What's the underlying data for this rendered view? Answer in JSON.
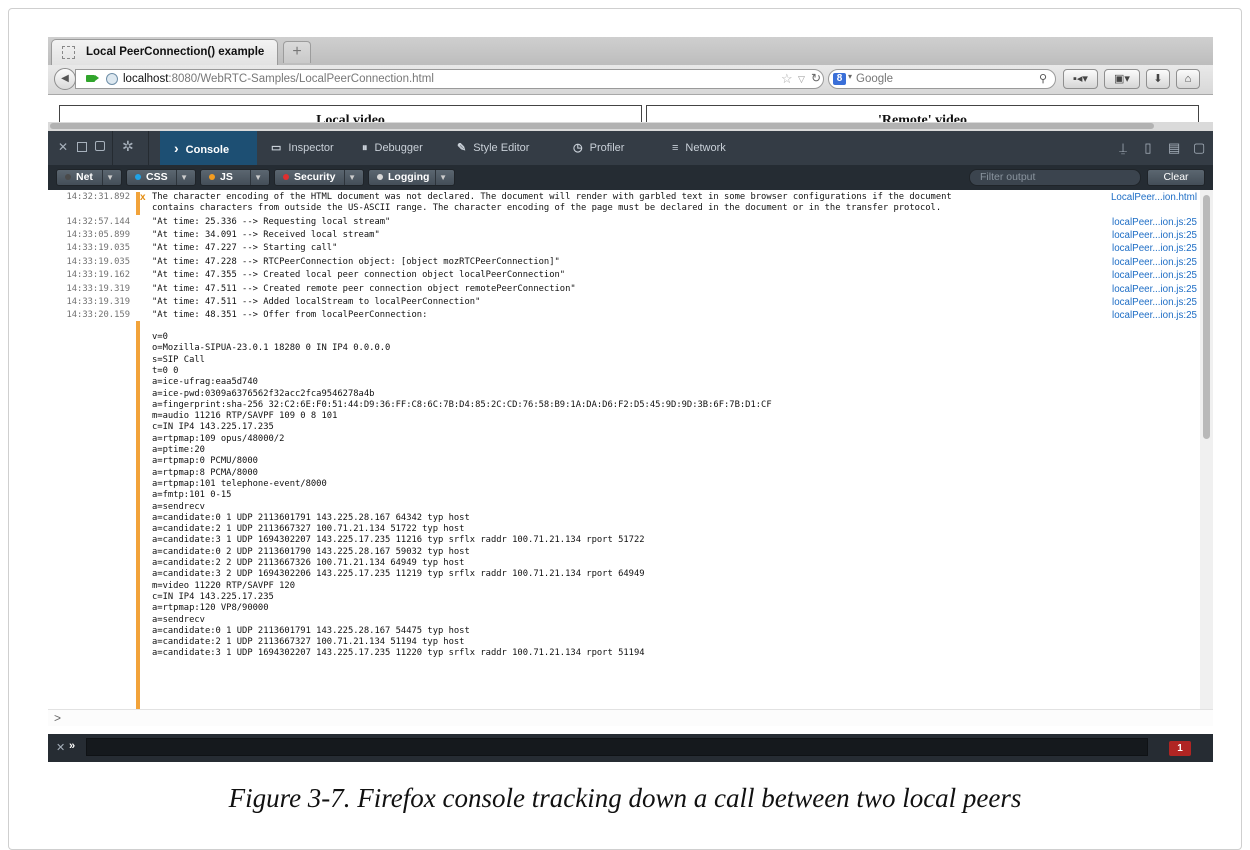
{
  "browser": {
    "tab_title": "Local PeerConnection() example",
    "new_tab_label": "+",
    "url_host": "localhost",
    "url_rest": ":8080/WebRTC-Samples/LocalPeerConnection.html",
    "search_engine_letter": "8",
    "search_placeholder": "Google"
  },
  "page": {
    "local_video_title": "Local video",
    "remote_video_title": "'Remote' video"
  },
  "devtools": {
    "tabs": [
      {
        "label": "Console",
        "icon": "chevron-right-icon"
      },
      {
        "label": "Inspector",
        "icon": "inspector-box-icon"
      },
      {
        "label": "Debugger",
        "icon": "pause-circle-icon"
      },
      {
        "label": "Style Editor",
        "icon": "pencil-icon"
      },
      {
        "label": "Profiler",
        "icon": "clock-icon"
      },
      {
        "label": "Network",
        "icon": "network-lines-icon"
      }
    ],
    "active_tab": "Console",
    "filters": [
      {
        "label": "Net",
        "dot_color": "#4a4a4a"
      },
      {
        "label": "CSS",
        "dot_color": "#1fa2e6"
      },
      {
        "label": "JS",
        "dot_color": "#f39c1f"
      },
      {
        "label": "Security",
        "dot_color": "#e02f2f"
      },
      {
        "label": "Logging",
        "dot_color": "#d8d8d8"
      }
    ],
    "filter_placeholder": "Filter output",
    "clear_label": "Clear",
    "error_count": "1"
  },
  "console": {
    "warning": {
      "time": "14:32:31.892",
      "icon": "x",
      "lines": [
        "The character encoding of the HTML document was not declared. The document will render with garbled text in some browser configurations if the document",
        "contains characters from outside the US-ASCII range. The character encoding of the page must be declared in the document or in the transfer protocol."
      ],
      "source": "LocalPeer...ion.html"
    },
    "messages": [
      {
        "time": "14:32:57.144",
        "text": "\"At time: 25.336 --> Requesting local stream\"",
        "source": "localPeer...ion.js:25"
      },
      {
        "time": "14:33:05.899",
        "text": "\"At time: 34.091 --> Received local stream\"",
        "source": "localPeer...ion.js:25"
      },
      {
        "time": "14:33:19.035",
        "text": "\"At time: 47.227 --> Starting call\"",
        "source": "localPeer...ion.js:25"
      },
      {
        "time": "14:33:19.035",
        "text": "\"At time: 47.228 --> RTCPeerConnection object: [object mozRTCPeerConnection]\"",
        "source": "localPeer...ion.js:25"
      },
      {
        "time": "14:33:19.162",
        "text": "\"At time: 47.355 --> Created local peer connection object localPeerConnection\"",
        "source": "localPeer...ion.js:25"
      },
      {
        "time": "14:33:19.319",
        "text": "\"At time: 47.511 --> Created remote peer connection object remotePeerConnection\"",
        "source": "localPeer...ion.js:25"
      },
      {
        "time": "14:33:19.319",
        "text": "\"At time: 47.511 --> Added localStream to localPeerConnection\"",
        "source": "localPeer...ion.js:25"
      },
      {
        "time": "14:33:20.159",
        "text": "\"At time: 48.351 --> Offer from localPeerConnection:",
        "source": "localPeer...ion.js:25"
      }
    ],
    "sdp_lines": [
      "v=0",
      "o=Mozilla-SIPUA-23.0.1 18280 0 IN IP4 0.0.0.0",
      "s=SIP Call",
      "t=0 0",
      "a=ice-ufrag:eaa5d740",
      "a=ice-pwd:0309a6376562f32acc2fca9546278a4b",
      "a=fingerprint:sha-256 32:C2:6E:F0:51:44:D9:36:FF:C8:6C:7B:D4:85:2C:CD:76:58:B9:1A:DA:D6:F2:D5:45:9D:9D:3B:6F:7B:D1:CF",
      "m=audio 11216 RTP/SAVPF 109 0 8 101",
      "c=IN IP4 143.225.17.235",
      "a=rtpmap:109 opus/48000/2",
      "a=ptime:20",
      "a=rtpmap:0 PCMU/8000",
      "a=rtpmap:8 PCMA/8000",
      "a=rtpmap:101 telephone-event/8000",
      "a=fmtp:101 0-15",
      "a=sendrecv",
      "a=candidate:0 1 UDP 2113601791 143.225.28.167 64342 typ host",
      "a=candidate:2 1 UDP 2113667327 100.71.21.134 51722 typ host",
      "a=candidate:3 1 UDP 1694302207 143.225.17.235 11216 typ srflx raddr 100.71.21.134 rport 51722",
      "a=candidate:0 2 UDP 2113601790 143.225.28.167 59032 typ host",
      "a=candidate:2 2 UDP 2113667326 100.71.21.134 64949 typ host",
      "a=candidate:3 2 UDP 1694302206 143.225.17.235 11219 typ srflx raddr 100.71.21.134 rport 64949",
      "m=video 11220 RTP/SAVPF 120",
      "c=IN IP4 143.225.17.235",
      "a=rtpmap:120 VP8/90000",
      "a=sendrecv",
      "a=candidate:0 1 UDP 2113601791 143.225.28.167 54475 typ host",
      "a=candidate:2 1 UDP 2113667327 100.71.21.134 51194 typ host",
      "a=candidate:3 1 UDP 1694302207 143.225.17.235 11220 typ srflx raddr 100.71.21.134 rport 51194"
    ],
    "prompt": ">"
  },
  "cmdbar": {
    "prompt": "»"
  },
  "caption": "Figure 3-7. Firefox console tracking down a call between two local peers"
}
